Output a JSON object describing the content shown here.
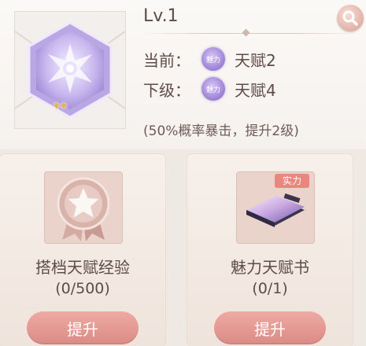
{
  "header": {
    "level": "Lv.1",
    "current_label": "当前：",
    "current_value": "天赋2",
    "next_label": "下级：",
    "next_value": "天赋4",
    "charm_icon_text": "魅力",
    "note": "(50%概率暴击，提升2级)"
  },
  "cards": [
    {
      "name": "搭档天赋经验",
      "count": "(0/500)",
      "button": "提升"
    },
    {
      "name": "魅力天赋书",
      "count": "(0/1)",
      "button": "提升",
      "tag": "实力"
    }
  ],
  "colors": {
    "accent": "#db8b85",
    "charm": "#9a7fd3",
    "star": "#e4b64a"
  }
}
